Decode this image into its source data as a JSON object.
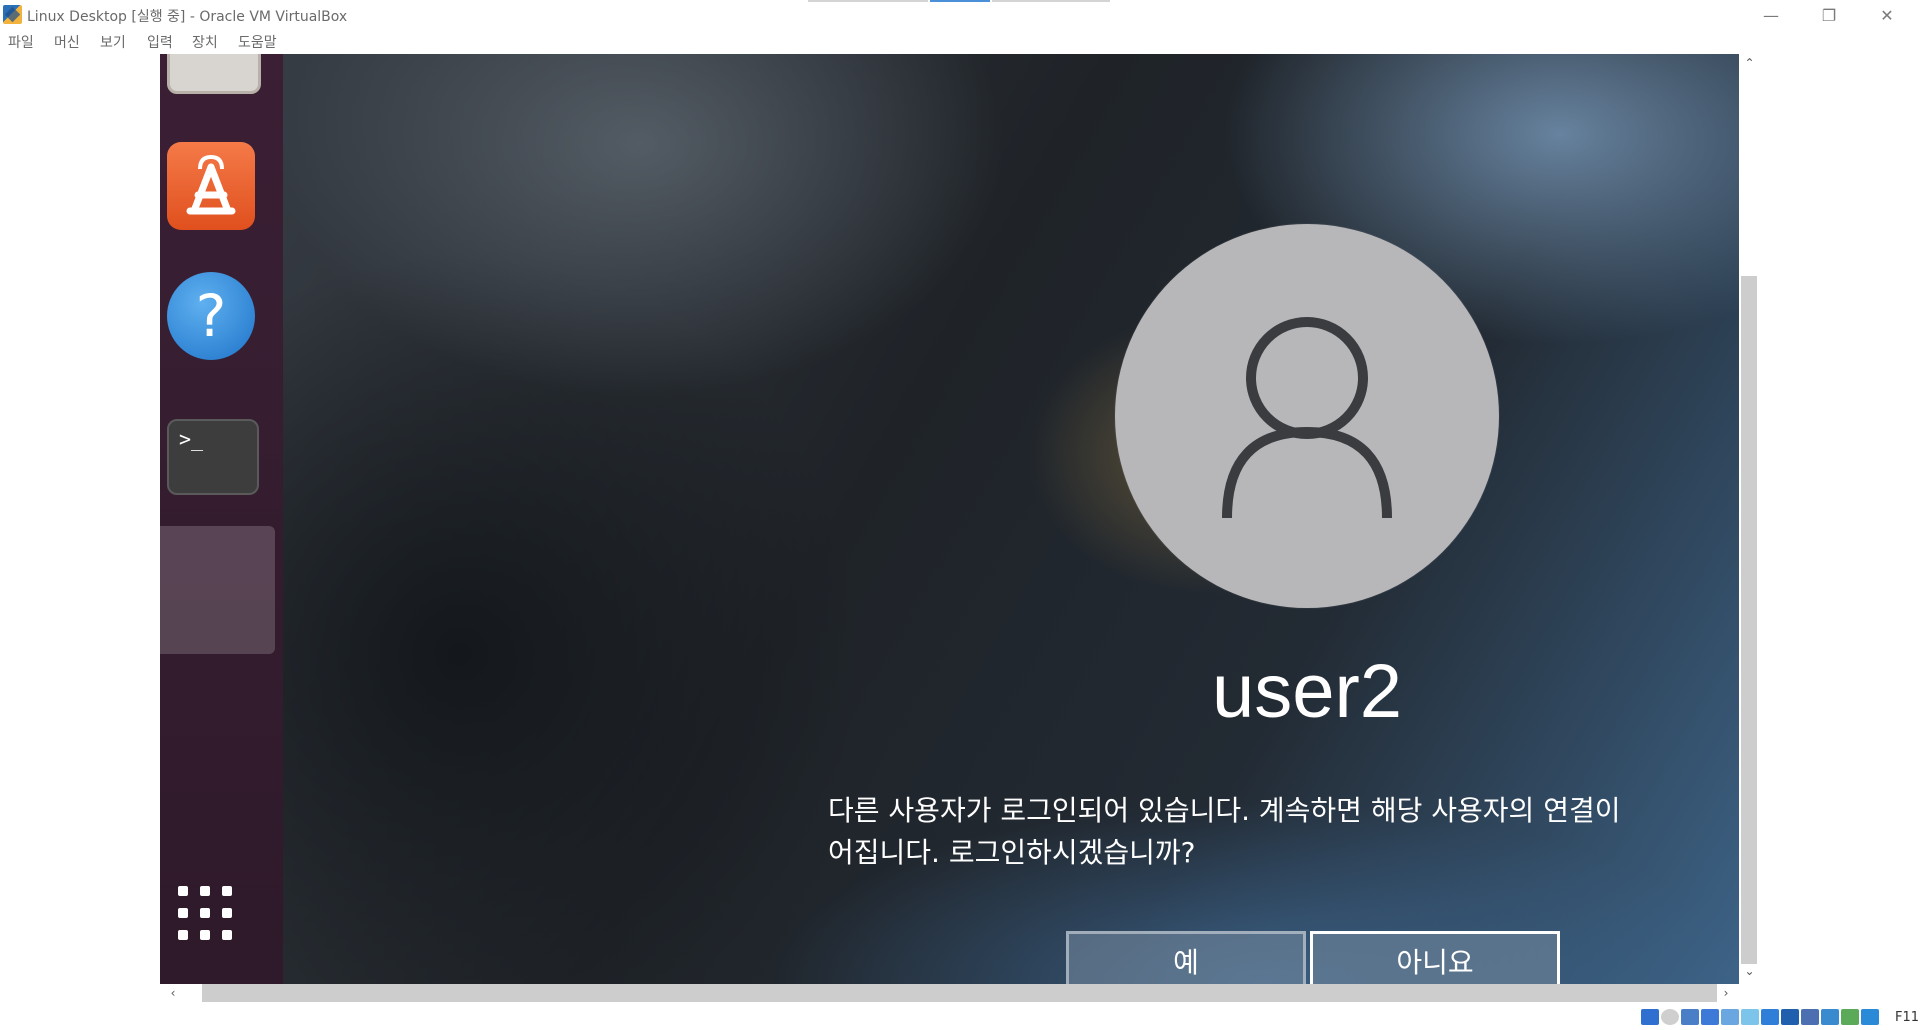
{
  "window": {
    "title": "Linux Desktop [실행 중] - Oracle VM VirtualBox",
    "minimize_glyph": "—",
    "restore_glyph": "❐",
    "close_glyph": "✕"
  },
  "menu": {
    "items": [
      "파일",
      "머신",
      "보기",
      "입력",
      "장치",
      "도움말"
    ]
  },
  "dock": {
    "apps": [
      {
        "name": "software-icon"
      },
      {
        "name": "help-icon",
        "glyph": "?"
      },
      {
        "name": "terminal-icon",
        "glyph": ">_"
      }
    ]
  },
  "login": {
    "username": "user2",
    "message": "다른 사용자가 로그인되어 있습니다. 계속하면 해당 사용자의 연결이\n어집니다. 로그인하시겠습니까?",
    "yes_label": "예",
    "no_label": "아니요"
  },
  "scroll": {
    "up": "⌃",
    "down": "⌄",
    "left": "‹",
    "right": "›"
  },
  "status": {
    "host_key": "F11",
    "icon_colors": [
      "#2f6fd0",
      "#cfcfcf",
      "#4a7fc8",
      "#3d7ad8",
      "#6aa6e0",
      "#7cc4ea",
      "#2f7ed8",
      "#1f5fae",
      "#4b6fb0",
      "#3a8ad0",
      "#5aaa5a",
      "#2a8ad8"
    ]
  },
  "colors": {
    "dock_bg": "#3b1f34",
    "software_orange": "#e9602c",
    "help_blue": "#2f86d8"
  }
}
